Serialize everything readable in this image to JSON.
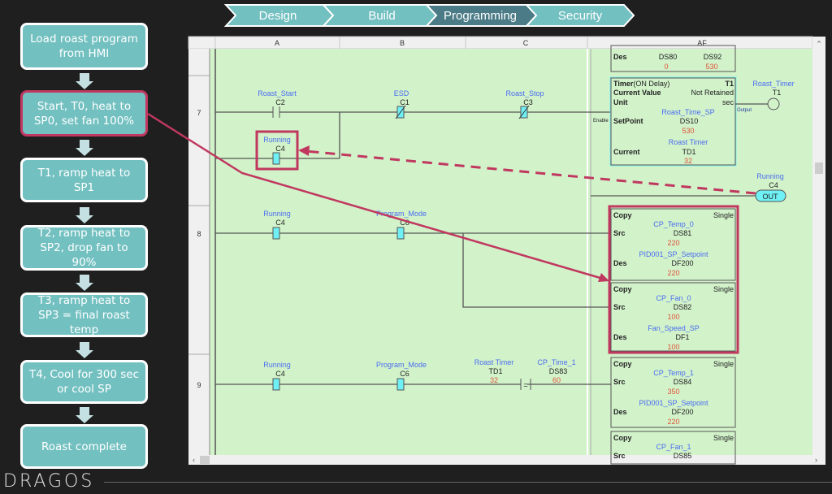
{
  "phases": [
    {
      "label": "Design",
      "active": false
    },
    {
      "label": "Build",
      "active": false
    },
    {
      "label": "Programming",
      "active": true
    },
    {
      "label": "Security",
      "active": false
    }
  ],
  "flow": [
    {
      "label": "Load roast program from HMI"
    },
    {
      "label": "Start, T0, heat to SP0, set fan 100%",
      "highlighted": true
    },
    {
      "label": "T1, ramp heat to SP1"
    },
    {
      "label": "T2, ramp heat to SP2, drop fan to 90%"
    },
    {
      "label": "T3, ramp heat to SP3 = final roast temp"
    },
    {
      "label": "T4, Cool for 300 sec or cool SP"
    },
    {
      "label": "Roast complete"
    }
  ],
  "ladder": {
    "columns": [
      "A",
      "B",
      "C",
      "AF"
    ],
    "rungs": [
      "7",
      "8",
      "9"
    ],
    "top_box": {
      "des": "Des",
      "a_addr": "DS80",
      "a_val": "0",
      "b_addr": "DS92",
      "b_val": "530"
    },
    "r7": {
      "c1": {
        "name": "Roast_Start",
        "addr": "C2"
      },
      "c2": {
        "name": "ESD",
        "addr": "C1"
      },
      "c3": {
        "name": "Roast_Stop",
        "addr": "C3"
      },
      "branch": {
        "name": "Running",
        "addr": "C4"
      },
      "timer": {
        "title": "Timer",
        "mode": "(ON Delay)",
        "id": "T1",
        "cv_label": "Current Value",
        "cv": "Not Retained",
        "unit_label": "Unit",
        "unit": "sec",
        "enable": "Enable",
        "output": "Output",
        "sp_label": "SetPoint",
        "sp_name": "Roast_Time_SP",
        "sp_addr": "DS10",
        "sp_val": "530",
        "cur_label": "Current",
        "cur_name": "Roast Timer",
        "cur_addr": "TD1",
        "cur_val": "32"
      },
      "coil": {
        "name": "Roast_Timer",
        "addr": "T1"
      },
      "out": {
        "name": "Running",
        "addr": "C4",
        "label": "OUT"
      }
    },
    "r8": {
      "c1": {
        "name": "Running",
        "addr": "C4"
      },
      "c2": {
        "name": "Program_Mode",
        "addr": "C6"
      },
      "copy1": {
        "title": "Copy",
        "mode": "Single",
        "src": "Src",
        "src_name": "CP_Temp_0",
        "src_addr": "DS81",
        "src_val": "220",
        "des": "Des",
        "des_name": "PID001_SP_Setpoint",
        "des_addr": "DF200",
        "des_val": "220"
      },
      "copy2": {
        "title": "Copy",
        "mode": "Single",
        "src": "Src",
        "src_name": "CP_Fan_0",
        "src_addr": "DS82",
        "src_val": "100",
        "des": "Des",
        "des_name": "Fan_Speed_SP",
        "des_addr": "DF1",
        "des_val": "100"
      }
    },
    "r9": {
      "c1": {
        "name": "Running",
        "addr": "C4"
      },
      "c2": {
        "name": "Program_Mode",
        "addr": "C6"
      },
      "cmp": {
        "a_name": "Roast Timer",
        "a_addr": "TD1",
        "a_val": "32",
        "op": "=",
        "b_name": "CP_Time_1",
        "b_addr": "DS83",
        "b_val": "60"
      },
      "copy1": {
        "title": "Copy",
        "mode": "Single",
        "src": "Src",
        "src_name": "CP_Temp_1",
        "src_addr": "DS84",
        "src_val": "350",
        "des": "Des",
        "des_name": "PID001_SP_Setpoint",
        "des_addr": "DF200",
        "des_val": "220"
      },
      "copy2": {
        "title": "Copy",
        "mode": "Single",
        "src": "Src",
        "src_name": "CP_Fan_1",
        "src_addr": "DS85"
      }
    }
  },
  "brand": "DRAGOS",
  "colors": {
    "bg": "#1f1f1f",
    "teal": "#73c0c1",
    "active_phase": "#4a7b86",
    "ladder_bg": "#d2f2ca",
    "tag_blue": "#4a6cf0",
    "value_red": "#e0533a",
    "contact_cyan": "#6ff0f5",
    "annotation": "#c0385f"
  }
}
